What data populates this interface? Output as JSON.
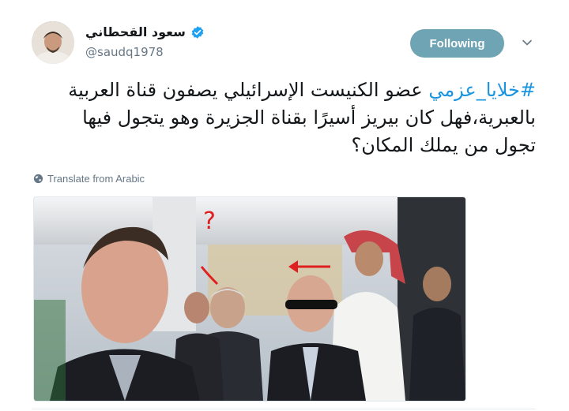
{
  "tweet": {
    "author_name": "سعود القحطاني",
    "author_handle": "@saudq1978",
    "follow_label": "Following",
    "hashtag": "#خلايا_عزمي",
    "text_line1_rest": " عضو الكنيست الإسرائيلي يصفون قناة العربية",
    "text_line2": "بالعبرية،فهل كان بيريز أسيرًا بقناة الجزيرة وهو يتجول فيها",
    "text_line3": "تجول من يملك المكان؟",
    "translate_label": "Translate from Arabic"
  },
  "icons": {
    "verified": "verified-badge-icon",
    "caret": "chevron-down-icon",
    "translate": "globe-icon"
  },
  "colors": {
    "follow_button": "#6ea4b3",
    "hashtag": "#1b95e0",
    "verified": "#1da1f2",
    "secondary_text": "#657786"
  }
}
